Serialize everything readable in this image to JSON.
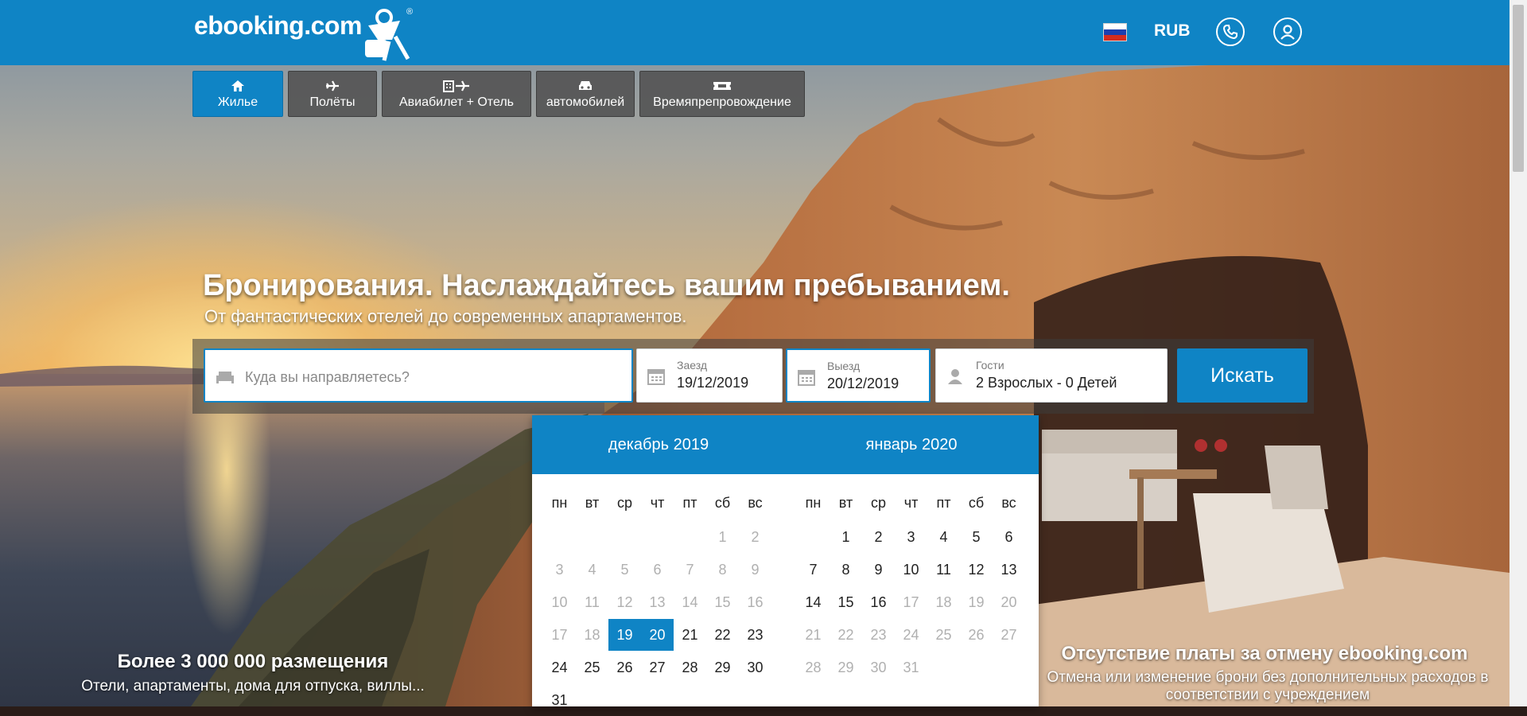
{
  "header": {
    "logo_text": "ebooking.com",
    "currency": "RUB",
    "brand_color": "#0f84c5"
  },
  "tabs": [
    {
      "label": "Жилье",
      "icon": "home-icon",
      "active": true
    },
    {
      "label": "Полёты",
      "icon": "plane-icon",
      "active": false
    },
    {
      "label": "Авиабилет + Отель",
      "icon": "hotel-plane-icon",
      "active": false
    },
    {
      "label": "автомобилей",
      "icon": "car-icon",
      "active": false
    },
    {
      "label": "Времяпрепровождение",
      "icon": "ticket-icon",
      "active": false
    }
  ],
  "hero": {
    "title": "Бронирования. Наслаждайтесь вашим пребыванием.",
    "subtitle": "От фантастических отелей до современных апартаментов."
  },
  "search": {
    "destination_placeholder": "Куда вы направляетесь?",
    "checkin_label": "Заезд",
    "checkin_value": "19/12/2019",
    "checkout_label": "Выезд",
    "checkout_value": "20/12/2019",
    "guests_label": "Гости",
    "guests_value": "2 Взрослых - 0 Детей",
    "button_label": "Искать"
  },
  "calendar": {
    "weekdays": [
      "пн",
      "вт",
      "ср",
      "чт",
      "пт",
      "сб",
      "вс"
    ],
    "months": [
      {
        "title": "декабрь 2019",
        "first_weekday": 6,
        "days": 31,
        "disabled_until": 18,
        "selected": [
          19,
          20
        ]
      },
      {
        "title": "январь 2020",
        "first_weekday": 2,
        "days": 31,
        "enabled_until": 16,
        "selected": []
      }
    ]
  },
  "features": {
    "left_title": "Более 3 000 000 размещения",
    "left_text": "Отели, апартаменты, дома для отпуска, виллы...",
    "right_title": "Отсутствие платы за отмену ebooking.com",
    "right_text": "Отмена или изменение брони без дополнительных расходов в соответствии с учреждением"
  }
}
